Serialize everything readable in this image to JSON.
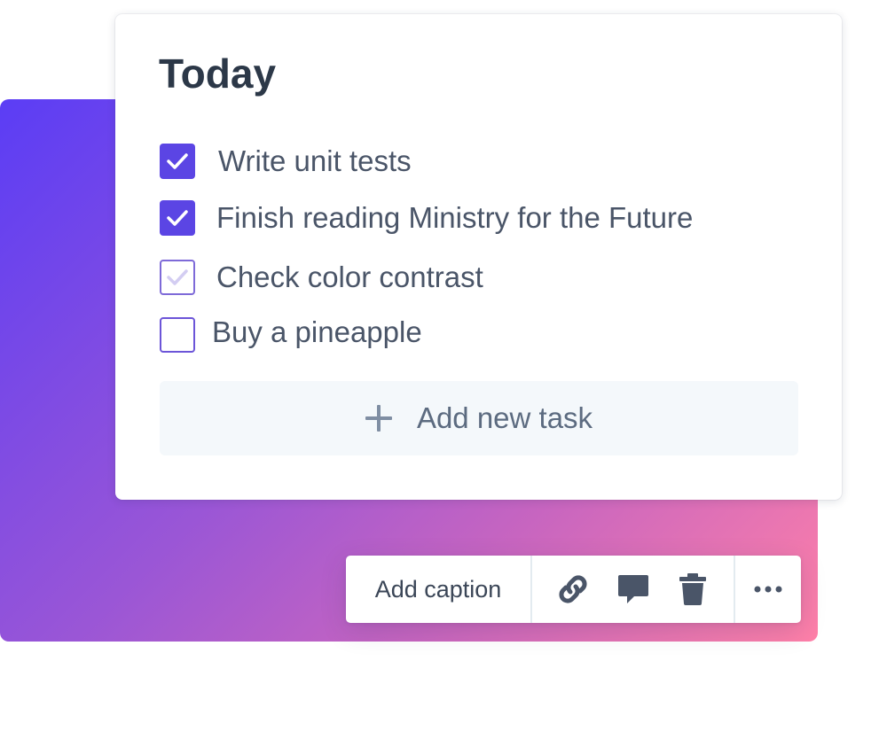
{
  "card": {
    "title": "Today",
    "tasks": [
      {
        "label": "Write unit tests",
        "state": "checked"
      },
      {
        "label": "Finish reading Ministry for the Future",
        "state": "checked"
      },
      {
        "label": "Check color contrast",
        "state": "faded-checked"
      },
      {
        "label": "Buy a pineapple",
        "state": "unchecked"
      }
    ],
    "add_task_label": "Add new task",
    "add_task_icon": "plus-icon"
  },
  "toolbar": {
    "caption_label": "Add caption",
    "icons": [
      "link-icon",
      "comment-icon",
      "trash-icon",
      "more-icon"
    ]
  },
  "colors": {
    "accent": "#5b45e4",
    "gradient_start": "#5b3df5",
    "gradient_end": "#ff80a8",
    "text": "#4a5568",
    "title": "#2c3848"
  }
}
